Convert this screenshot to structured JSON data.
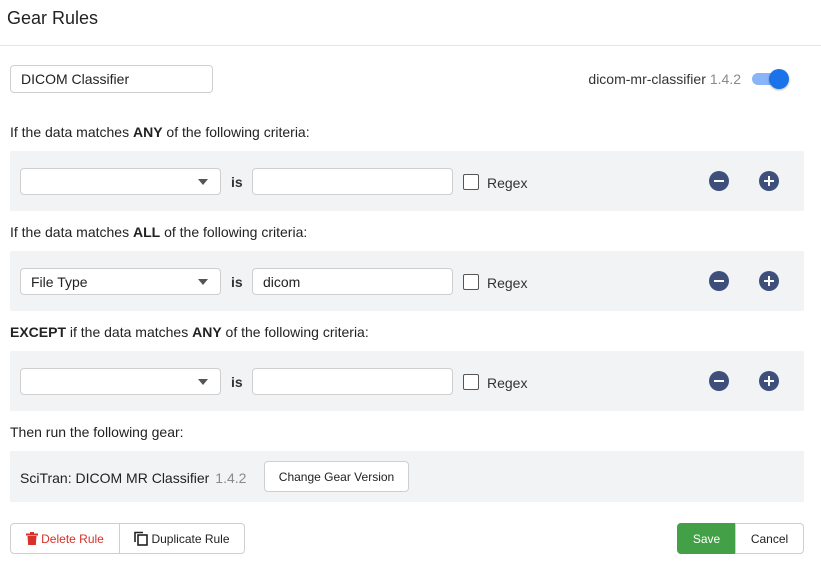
{
  "header": {
    "title": "Gear Rules"
  },
  "rule": {
    "name": "DICOM Classifier",
    "gear_id": "dicom-mr-classifier",
    "gear_version": "1.4.2",
    "enabled": true
  },
  "sections": {
    "any": {
      "prefix": "If the data matches ",
      "keyword": "ANY",
      "suffix": " of the following criteria:"
    },
    "all": {
      "prefix": "If the data matches ",
      "keyword": "ALL",
      "suffix": " of the following criteria:"
    },
    "except": {
      "keyword1": "EXCEPT",
      "middle": " if the data matches ",
      "keyword2": "ANY",
      "suffix": " of the following criteria:"
    }
  },
  "criteria": {
    "any": {
      "field": "",
      "operator": "is",
      "value": "",
      "regex_label": "Regex",
      "regex_checked": false
    },
    "all": {
      "field": "File Type",
      "operator": "is",
      "value": "dicom",
      "regex_label": "Regex",
      "regex_checked": false
    },
    "except": {
      "field": "",
      "operator": "is",
      "value": "",
      "regex_label": "Regex",
      "regex_checked": false
    }
  },
  "run": {
    "label": "Then run the following gear:",
    "gear_name": "SciTran: DICOM MR Classifier",
    "gear_version": "1.4.2",
    "change_version_label": "Change Gear Version"
  },
  "actions": {
    "delete_label": "Delete Rule",
    "duplicate_label": "Duplicate Rule",
    "save_label": "Save",
    "cancel_label": "Cancel"
  },
  "colors": {
    "accent": "#1a73e8",
    "save": "#43a047",
    "danger": "#d9302a",
    "round_button": "#3e4f7c"
  },
  "icons": [
    "minus-circle-icon",
    "plus-circle-icon",
    "trash-icon",
    "copy-icon",
    "chevron-down-icon"
  ]
}
